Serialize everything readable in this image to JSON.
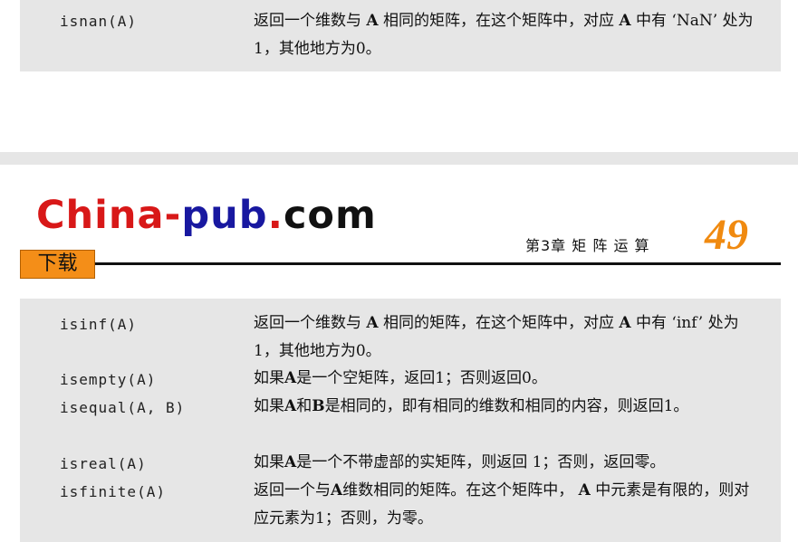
{
  "top_table": {
    "rows": [
      {
        "fn": "isnan(A)",
        "desc": [
          "返回一个维数与 ",
          "A",
          " 相同的矩阵，在这个矩阵中，对应 ",
          "A",
          " 中有 ‘NaN’ 处为1，其他地方为0。"
        ]
      }
    ]
  },
  "header": {
    "logo": {
      "part1": "China",
      "dash": "-",
      "part2": "pub",
      "dot": ".",
      "part3": "com"
    },
    "download": "下载",
    "chapter": "第3章  矩 阵 运 算",
    "page_number": "49",
    "colors": {
      "logo_red": "#d81818",
      "logo_blue": "#1818a0",
      "accent": "#f08a10"
    }
  },
  "main_table": {
    "rows": [
      {
        "fn": "isinf(A)",
        "desc": [
          "返回一个维数与 ",
          "A",
          " 相同的矩阵，在这个矩阵中，对应 ",
          "A",
          " 中有 ‘inf’ 处为1，其他地方为0。"
        ]
      },
      {
        "fn": "isempty(A)",
        "desc": [
          "如果",
          "A",
          "是一个空矩阵，返回1；否则返回0。"
        ]
      },
      {
        "fn": "isequal(A, B)",
        "desc": [
          "如果",
          "A",
          "和",
          "B",
          "是相同的，即有相同的维数和相同的内容，则返回1。"
        ]
      },
      {
        "fn": "isreal(A)",
        "desc": [
          "如果",
          "A",
          "是一个不带虚部的实矩阵，则返回 1；否则，返回零。"
        ]
      },
      {
        "fn": "isfinite(A)",
        "desc": [
          "返回一个与",
          "A",
          "维数相同的矩阵。在这个矩阵中，  ",
          "A",
          " 中元素是有限的，则对应元素为1；否则，为零。"
        ]
      }
    ]
  }
}
